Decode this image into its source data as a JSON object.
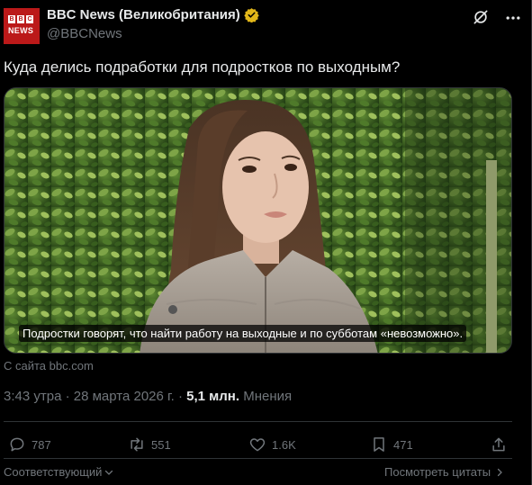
{
  "account": {
    "name": "BBC News (Великобритания)",
    "handle": "@BBCNews",
    "avatar_letters": [
      "B",
      "B",
      "C"
    ],
    "avatar_word": "NEWS",
    "avatar_color": "#bb1919",
    "badge_color": "#e2b719"
  },
  "tweet": {
    "text": "Куда делись подработки для подростков по выходным?",
    "image_caption": "Подростки говорят, что найти работу на выходные и по субботам «невозможно».",
    "source": "С сайта bbc.com",
    "time": "3:43 утра · 28 марта 2026 г. · ",
    "views_count": "5,1 млн.",
    "views_label": " Мнения"
  },
  "actions": {
    "replies": "787",
    "reposts": "551",
    "likes": "1.6K",
    "bookmarks": "471"
  },
  "footer": {
    "sort_label": "Соответствующий",
    "quotes_label": "Посмотреть цитаты"
  },
  "colors": {
    "background": "#000000",
    "text": "#e7e9ea",
    "muted": "#71767b",
    "border": "#2f3336"
  }
}
